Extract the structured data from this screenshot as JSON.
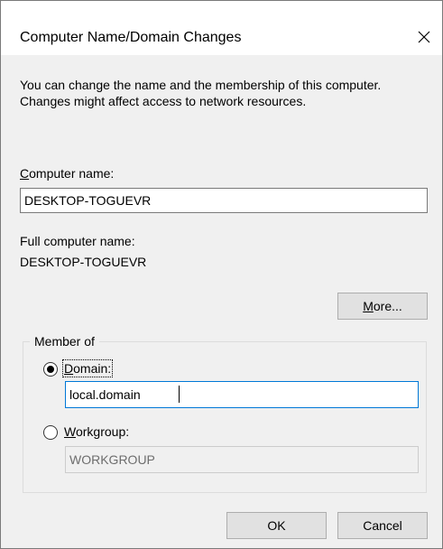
{
  "window": {
    "title": "Computer Name/Domain Changes",
    "close_glyph": "close-icon"
  },
  "description": "You can change the name and the membership of this computer. Changes might affect access to network resources.",
  "computer_name": {
    "label_first": "C",
    "label_rest": "omputer name:",
    "value": "DESKTOP-TOGUEVR"
  },
  "full_computer_name": {
    "label": "Full computer name:",
    "value": "DESKTOP-TOGUEVR"
  },
  "more_button": {
    "label_first": "M",
    "label_rest": "ore..."
  },
  "member_of": {
    "label": "Member of",
    "domain": {
      "label_first": "D",
      "label_rest": "omain:",
      "value": "local.domain",
      "selected": true
    },
    "workgroup": {
      "label_first": "W",
      "label_rest": "orkgroup:",
      "value": "WORKGROUP",
      "selected": false
    }
  },
  "ok_button": {
    "label": "OK"
  },
  "cancel_button": {
    "label": "Cancel"
  },
  "colors": {
    "dialog_bg": "#f0f0f0",
    "titlebar_bg": "#ffffff",
    "focus_border": "#0078d7"
  }
}
